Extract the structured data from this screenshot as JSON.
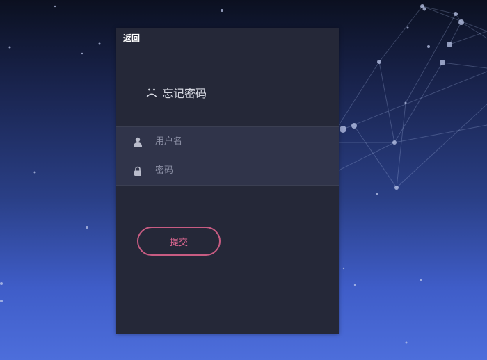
{
  "header": {
    "back_label": "返回"
  },
  "form": {
    "title": "忘记密码",
    "title_icon": "sad-face-icon",
    "fields": [
      {
        "name": "username",
        "icon": "user-icon",
        "placeholder": "用户名"
      },
      {
        "name": "password",
        "icon": "lock-icon",
        "placeholder": "密码"
      }
    ],
    "submit_label": "提交"
  },
  "colors": {
    "panel_bg": "#252838",
    "field_bg": "#30344a",
    "accent": "#d9668f",
    "bg_top": "#0b1020",
    "bg_bottom": "#4d6edb"
  }
}
